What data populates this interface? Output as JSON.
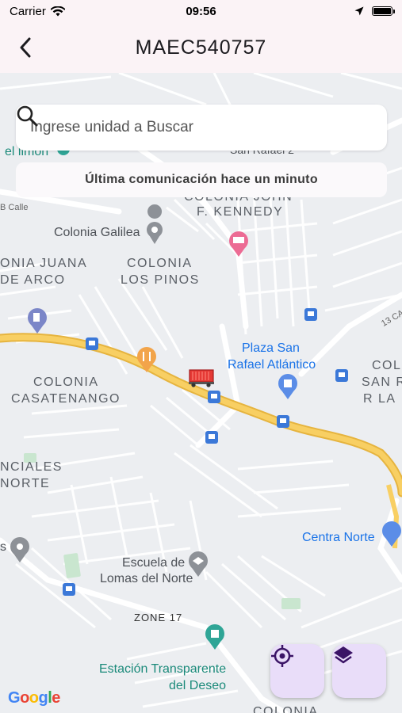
{
  "status_bar": {
    "carrier": "Carrier",
    "time": "09:56"
  },
  "header": {
    "title": "MAEC540757"
  },
  "search": {
    "placeholder": "Ingrese unidad a Buscar"
  },
  "last_communication": "Última comunicación hace un minuto",
  "map": {
    "labels": {
      "el_limon": "el limón",
      "san_rafael_2": "San Rafael 2",
      "colonia_john_top": "COLONIA JOHN",
      "kennedy": "F. KENNEDY",
      "calle_b": "B Calle",
      "colonia_galilea": "Colonia Galilea",
      "juana_1": "ONIA JUANA",
      "juana_2": "DE ARCO",
      "pinos_1": "COLONIA",
      "pinos_2": "LOS PINOS",
      "plaza_1": "Plaza San",
      "plaza_2": "Rafael Atlántico",
      "casa_1": "COLONIA",
      "casa_2": "CASATENANGO",
      "sanraf_1": "COL",
      "sanraf_2": "SAN R",
      "sanraf_3": "R LA",
      "ncial_1": "NCIALES",
      "ncial_2": "NORTE",
      "centra_norte": "Centra Norte",
      "escuela_1": "Escuela de",
      "escuela_2": "Lomas del Norte",
      "zone17": "ZONE 17",
      "estacion_1": "Estación Transparente",
      "estacion_2": "del Deseo",
      "colonia_bottom": "COLONIA",
      "calle13": "13 CA",
      "s_left": "s"
    },
    "google_logo": "Google"
  },
  "icons": {
    "back": "back-arrow-icon",
    "search": "search-icon",
    "locate": "crosshair-icon",
    "layers": "layers-icon",
    "vehicle": "truck-icon"
  },
  "colors": {
    "route": "#f6c24a",
    "header_bg": "#fbf3f6",
    "fab_bg": "#e9ddf9",
    "accent": "#4a148c",
    "poi_blue": "#1a73e8"
  }
}
